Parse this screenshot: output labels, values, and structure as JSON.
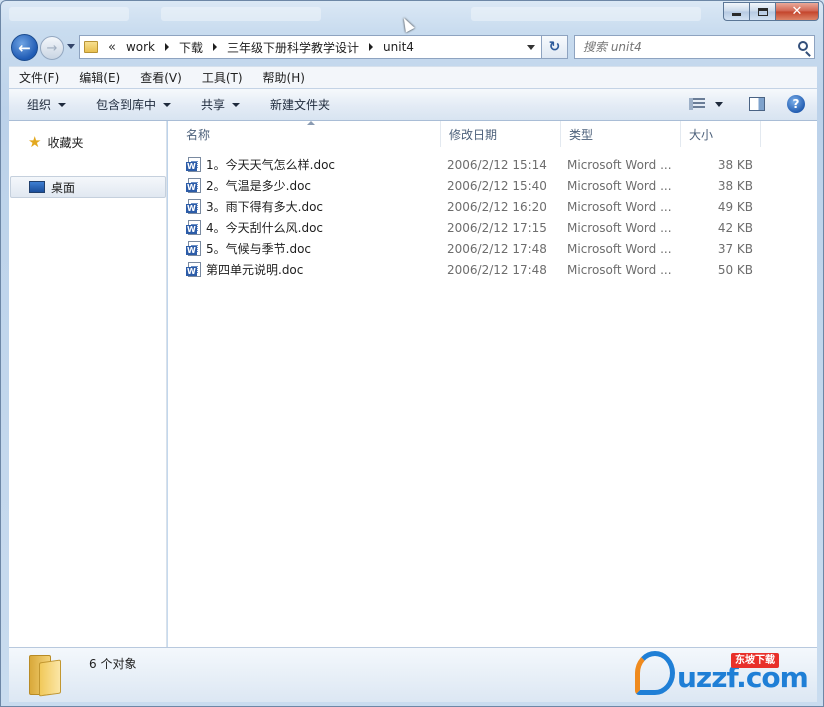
{
  "nav": {
    "breadcrumb_overflow": "«",
    "breadcrumbs": [
      "work",
      "下载",
      "三年级下册科学教学设计",
      "unit4"
    ],
    "search_placeholder": "搜索 unit4"
  },
  "menu": [
    "文件(F)",
    "编辑(E)",
    "查看(V)",
    "工具(T)",
    "帮助(H)"
  ],
  "toolbar": {
    "organize": "组织",
    "include_in_library": "包含到库中",
    "share": "共享",
    "new_folder": "新建文件夹"
  },
  "sidebar": {
    "items": [
      {
        "label": "收藏夹",
        "icon": "star-icon"
      },
      {
        "label": "桌面",
        "icon": "desktop-icon",
        "selected": true
      }
    ]
  },
  "columns": {
    "name": "名称",
    "date": "修改日期",
    "type": "类型",
    "size": "大小"
  },
  "files": [
    {
      "name": "1。今天天气怎么样.doc",
      "date": "2006/2/12 15:14",
      "type": "Microsoft Word ...",
      "size": "38 KB"
    },
    {
      "name": "2。气温是多少.doc",
      "date": "2006/2/12 15:40",
      "type": "Microsoft Word ...",
      "size": "38 KB"
    },
    {
      "name": "3。雨下得有多大.doc",
      "date": "2006/2/12 16:20",
      "type": "Microsoft Word ...",
      "size": "49 KB"
    },
    {
      "name": "4。今天刮什么风.doc",
      "date": "2006/2/12 17:15",
      "type": "Microsoft Word ...",
      "size": "42 KB"
    },
    {
      "name": "5。气候与季节.doc",
      "date": "2006/2/12 17:48",
      "type": "Microsoft Word ...",
      "size": "37 KB"
    },
    {
      "name": "第四单元说明.doc",
      "date": "2006/2/12 17:48",
      "type": "Microsoft Word ...",
      "size": "50 KB"
    }
  ],
  "status": {
    "count_text": "6 个对象"
  },
  "watermark": {
    "text": "uzzf.com",
    "badge": "东坡下载"
  },
  "colors": {
    "accent": "#1f5bb4",
    "selection": "#e1e8f1",
    "close_button": "#c3432a"
  }
}
